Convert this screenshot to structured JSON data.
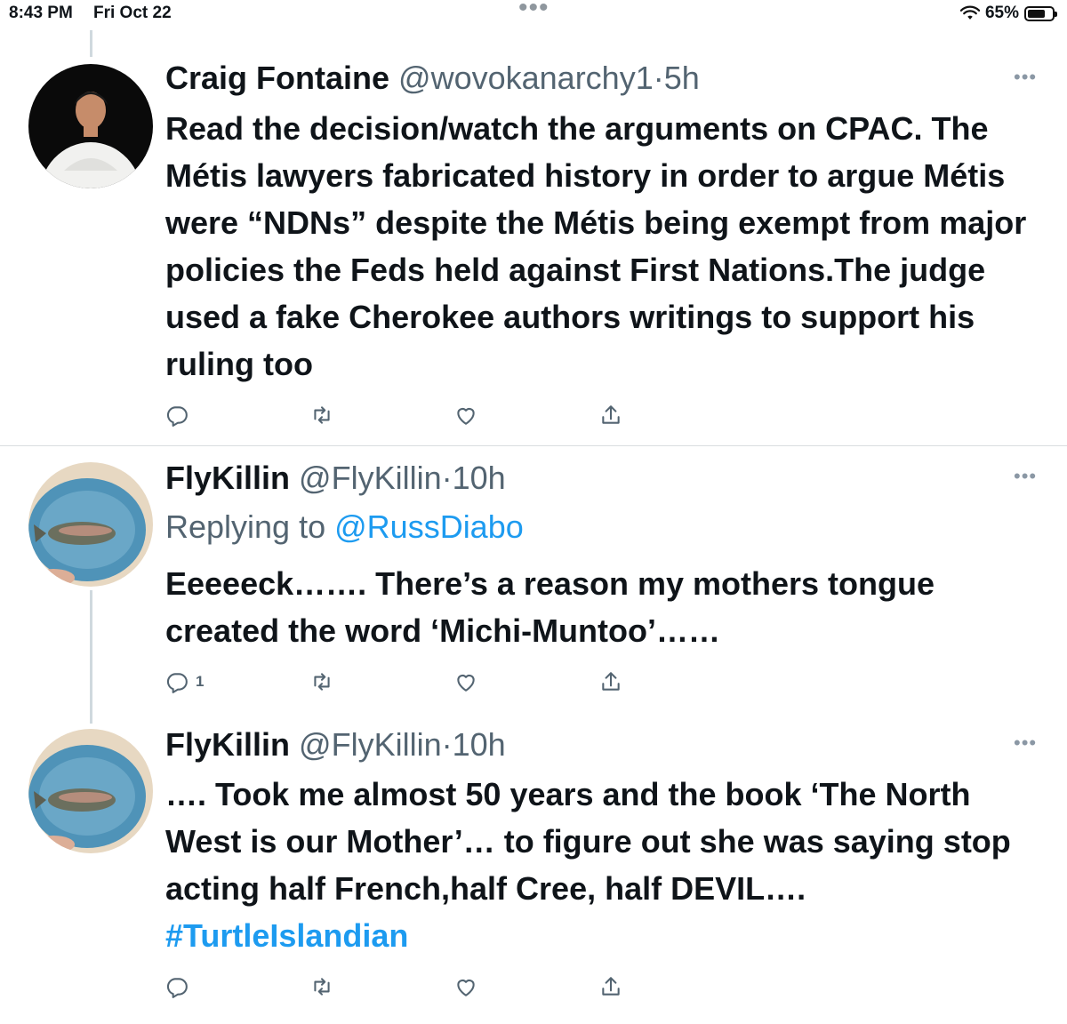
{
  "status_bar": {
    "time": "8:43 PM",
    "date": "Fri Oct 22",
    "dots": "•••",
    "battery": "65%"
  },
  "tweets": [
    {
      "name": "Craig Fontaine",
      "handle": "@wovokanarchy1",
      "sep": "·",
      "time": "5h",
      "text": "Read the decision/watch the arguments on CPAC. The Métis lawyers fabricated history in order to argue Métis were “NDNs” despite the Métis being exempt from major policies the Feds held against First Nations.The judge used a fake Cherokee authors writings to support his ruling too",
      "reply_count": ""
    },
    {
      "name": "FlyKillin",
      "handle": "@FlyKillin",
      "sep": "·",
      "time": "10h",
      "replying_label": "Replying to",
      "replying_to": "@RussDiabo",
      "text": "Eeeeeck……. There’s a reason my mothers tongue created the word ‘Michi-Muntoo’……",
      "reply_count": "1"
    },
    {
      "name": "FlyKillin",
      "handle": "@FlyKillin",
      "sep": "·",
      "time": "10h",
      "text": "…. Took me almost 50 years and the book ‘The North West is our Mother’… to figure out she was saying stop acting half French,half Cree, half DEVIL….",
      "hashtag": "#TurtleIslandian",
      "reply_count": ""
    }
  ],
  "more_glyph": "•••",
  "icons": {
    "reply": "reply-icon",
    "retweet": "retweet-icon",
    "like": "heart-icon",
    "share": "share-icon"
  },
  "colors": {
    "accent": "#1d9bf0",
    "secondary_text": "#536471",
    "icon": "#536471"
  }
}
